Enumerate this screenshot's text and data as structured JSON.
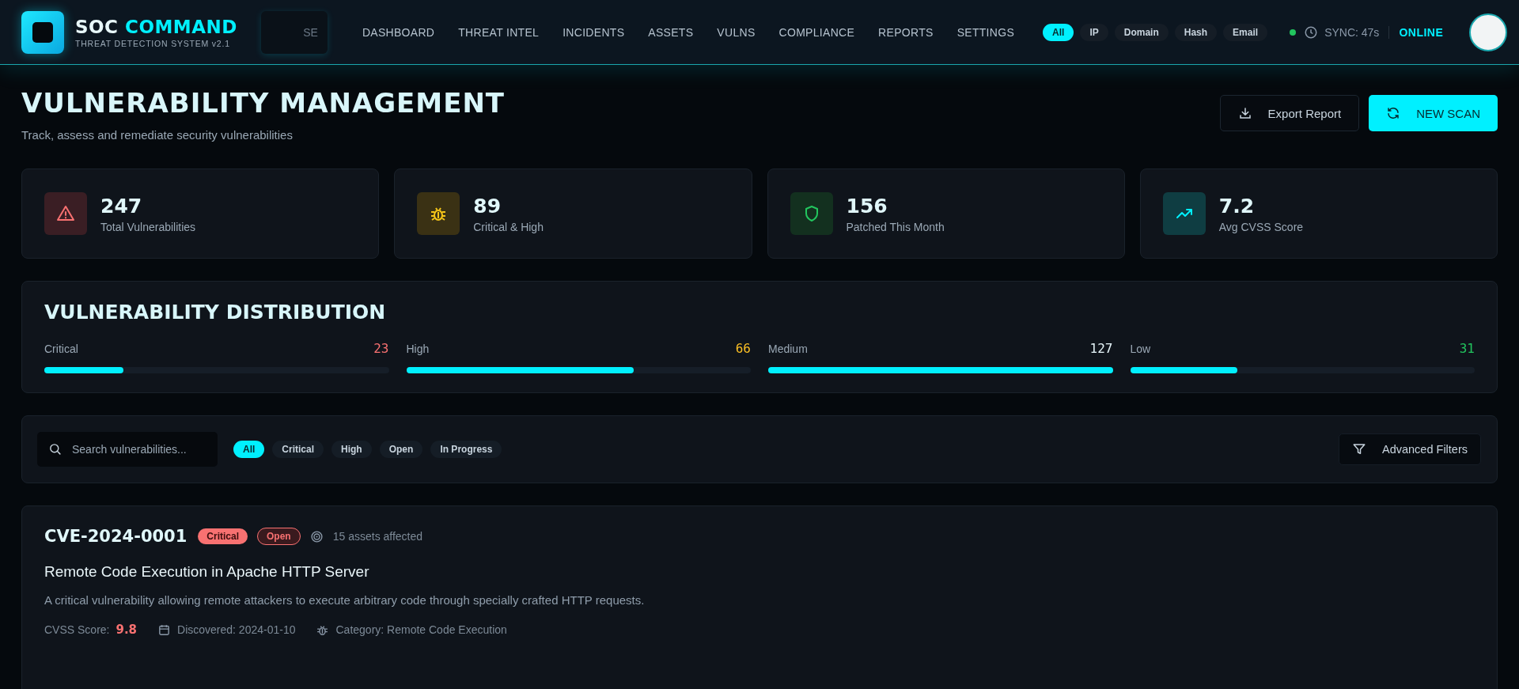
{
  "header": {
    "brand_primary": "SOC",
    "brand_accent": "COMMAND",
    "subtitle": "THREAT DETECTION SYSTEM v2.1",
    "search_value": "SE",
    "nav": [
      {
        "label": "DASHBOARD",
        "selected": false
      },
      {
        "label": "THREAT INTEL",
        "selected": false
      },
      {
        "label": "INCIDENTS",
        "selected": false
      },
      {
        "label": "ASSETS",
        "selected": false
      },
      {
        "label": "VULNS",
        "selected": false
      },
      {
        "label": "COMPLIANCE",
        "selected": false
      },
      {
        "label": "REPORTS",
        "selected": false
      },
      {
        "label": "SETTINGS",
        "selected": false
      }
    ],
    "ioc_filters": [
      {
        "label": "All",
        "selected": true
      },
      {
        "label": "IP",
        "selected": false
      },
      {
        "label": "Domain",
        "selected": false
      },
      {
        "label": "Hash",
        "selected": false
      },
      {
        "label": "Email",
        "selected": false
      }
    ],
    "sync": "SYNC: 47s",
    "status": "ONLINE"
  },
  "page": {
    "title": "VULNERABILITY MANAGEMENT",
    "subtitle": "Track, assess and remediate security vulnerabilities",
    "buttons": [
      {
        "label": "Export Report",
        "kind": "secondary"
      },
      {
        "label": "NEW SCAN",
        "kind": "primary"
      }
    ]
  },
  "stats": [
    {
      "kind": "warning",
      "value": "247",
      "label": "Total Vulnerabilities"
    },
    {
      "kind": "bug",
      "value": "89",
      "label": "Critical & High"
    },
    {
      "kind": "shield",
      "value": "156",
      "label": "Patched This Month"
    },
    {
      "kind": "trend",
      "value": "7.2",
      "label": "Avg CVSS Score"
    }
  ],
  "distribution": {
    "title": "VULNERABILITY DISTRIBUTION",
    "items": [
      {
        "label": "Critical",
        "count": "23",
        "color": "#f87171",
        "level": 0.23
      },
      {
        "label": "High",
        "count": "66",
        "color": "#fbbf24",
        "level": 0.66
      },
      {
        "label": "Medium",
        "count": "127",
        "color": "#e5f4f8",
        "level": 1.0
      },
      {
        "label": "Low",
        "count": "31",
        "color": "#22c55e",
        "level": 0.31
      }
    ]
  },
  "filters": {
    "placeholder": "Search vulnerabilities...",
    "chips": [
      {
        "label": "All",
        "selected": true
      },
      {
        "label": "Critical",
        "selected": false
      },
      {
        "label": "High",
        "selected": false
      },
      {
        "label": "Open",
        "selected": false
      },
      {
        "label": "In Progress",
        "selected": false
      }
    ],
    "advanced": "Advanced Filters"
  },
  "vulnerabilities": [
    {
      "id": "CVE-2024-0001",
      "severity": "Critical",
      "status": "Open",
      "assets": "15 assets affected",
      "title": "Remote Code Execution in Apache HTTP Server",
      "description": "A critical vulnerability allowing remote attackers to execute arbitrary code through specially crafted HTTP requests.",
      "cvss_label": "CVSS Score:",
      "cvss": "9.8",
      "discovered": "Discovered: 2024-01-10",
      "category": "Category: Remote Code Execution"
    }
  ]
}
